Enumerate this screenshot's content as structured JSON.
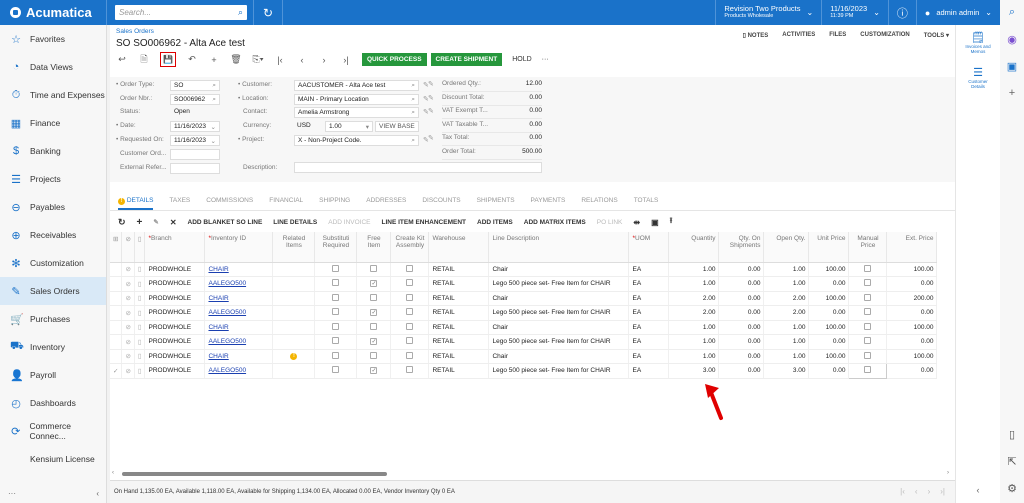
{
  "app": {
    "name": "Acumatica",
    "search_placeholder": "Search..."
  },
  "topbar": {
    "company_line1": "Revision Two Products",
    "company_line2": "Products Wholesale",
    "date_line1": "11/16/2023",
    "date_line2": "11:39 PM",
    "user": "admin admin"
  },
  "sidebar": {
    "items": [
      {
        "label": "Favorites",
        "icon": "star-icon",
        "glyph": "☆"
      },
      {
        "label": "Data Views",
        "icon": "pie-chart-icon",
        "glyph": "◔"
      },
      {
        "label": "Time and Expenses",
        "icon": "stopwatch-icon",
        "glyph": "⏱"
      },
      {
        "label": "Finance",
        "icon": "calculator-icon",
        "glyph": "▦"
      },
      {
        "label": "Banking",
        "icon": "dollar-icon",
        "glyph": "$"
      },
      {
        "label": "Projects",
        "icon": "projects-icon",
        "glyph": "☰"
      },
      {
        "label": "Payables",
        "icon": "minus-circle-icon",
        "glyph": "⊖"
      },
      {
        "label": "Receivables",
        "icon": "plus-circle-icon",
        "glyph": "⊕"
      },
      {
        "label": "Customization",
        "icon": "puzzle-icon",
        "glyph": "✻"
      },
      {
        "label": "Sales Orders",
        "icon": "edit-icon",
        "glyph": "✎",
        "active": true
      },
      {
        "label": "Purchases",
        "icon": "cart-icon",
        "glyph": "🛒"
      },
      {
        "label": "Inventory",
        "icon": "truck-icon",
        "glyph": "⛟"
      },
      {
        "label": "Payroll",
        "icon": "payroll-icon",
        "glyph": "👤"
      },
      {
        "label": "Dashboards",
        "icon": "gauge-icon",
        "glyph": "◴"
      },
      {
        "label": "Commerce Connec...",
        "icon": "sync-icon",
        "glyph": "⟳"
      },
      {
        "label": "Kensium License",
        "icon": "",
        "glyph": ""
      }
    ]
  },
  "page": {
    "breadcrumb": "Sales Orders",
    "title": "SO SO006962 - Alta Ace test",
    "top_tools": [
      "NOTES",
      "ACTIVITIES",
      "FILES",
      "CUSTOMIZATION",
      "TOOLS ▾"
    ],
    "actions": {
      "quick_process": "QUICK PROCESS",
      "create_shipment": "CREATE SHIPMENT",
      "hold": "HOLD",
      "more": "···"
    }
  },
  "form": {
    "order_type_label": "Order Type:",
    "order_type": "SO",
    "order_nbr_label": "Order Nbr.:",
    "order_nbr": "SO006962",
    "status_label": "Status:",
    "status": "Open",
    "date_label": "Date:",
    "date": "11/16/2023",
    "requested_on_label": "Requested On:",
    "requested_on": "11/16/2023",
    "customer_ord_label": "Customer Ord...",
    "customer_ord": "",
    "external_ref_label": "External Refer...",
    "external_ref": "",
    "customer_label": "Customer:",
    "customer": "AACUSTOMER - Alta Ace test",
    "location_label": "Location:",
    "location": "MAIN - Primary Location",
    "contact_label": "Contact:",
    "contact": "Amelia Armstrong",
    "currency_label": "Currency:",
    "currency": "USD",
    "rate": "1.00",
    "view_base": "VIEW BASE",
    "project_label": "Project:",
    "project": "X - Non-Project Code.",
    "description_label": "Description:",
    "description": "",
    "totals": [
      {
        "label": "Ordered Qty.:",
        "value": "12.00"
      },
      {
        "label": "Discount Total:",
        "value": "0.00"
      },
      {
        "label": "VAT Exempt T...",
        "value": "0.00"
      },
      {
        "label": "VAT Taxable T...",
        "value": "0.00"
      },
      {
        "label": "Tax Total:",
        "value": "0.00"
      },
      {
        "label": "Order Total:",
        "value": "500.00"
      }
    ]
  },
  "tabs": [
    "DETAILS",
    "TAXES",
    "COMMISSIONS",
    "FINANCIAL",
    "SHIPPING",
    "ADDRESSES",
    "DISCOUNTS",
    "SHIPMENTS",
    "PAYMENTS",
    "RELATIONS",
    "TOTALS"
  ],
  "grid_toolbar": [
    "ADD BLANKET SO LINE",
    "LINE DETAILS",
    "ADD INVOICE",
    "LINE ITEM ENHANCEMENT",
    "ADD ITEMS",
    "ADD MATRIX ITEMS",
    "PO LINK"
  ],
  "grid": {
    "columns": [
      "Branch",
      "Inventory ID",
      "Related Items",
      "Substituti Required",
      "Free Item",
      "Create Kit Assembly",
      "Warehouse",
      "Line Description",
      "UOM",
      "Quantity",
      "Qty. On Shipments",
      "Open Qty.",
      "Unit Price",
      "Manual Price",
      "Ext. Price"
    ],
    "rows": [
      {
        "branch": "PRODWHOLE",
        "item": "CHAIR",
        "free": false,
        "warehouse": "RETAIL",
        "desc": "Chair",
        "uom": "EA",
        "qty": "1.00",
        "ship": "0.00",
        "open": "1.00",
        "price": "100.00",
        "ext": "100.00"
      },
      {
        "branch": "PRODWHOLE",
        "item": "AALEGO500",
        "free": true,
        "warehouse": "RETAIL",
        "desc": "Lego 500 piece set- Free Item for CHAIR",
        "uom": "EA",
        "qty": "1.00",
        "ship": "0.00",
        "open": "1.00",
        "price": "0.00",
        "ext": "0.00"
      },
      {
        "branch": "PRODWHOLE",
        "item": "CHAIR",
        "free": false,
        "warehouse": "RETAIL",
        "desc": "Chair",
        "uom": "EA",
        "qty": "2.00",
        "ship": "0.00",
        "open": "2.00",
        "price": "100.00",
        "ext": "200.00"
      },
      {
        "branch": "PRODWHOLE",
        "item": "AALEGO500",
        "free": true,
        "warehouse": "RETAIL",
        "desc": "Lego 500 piece set- Free Item for CHAIR",
        "uom": "EA",
        "qty": "2.00",
        "ship": "0.00",
        "open": "2.00",
        "price": "0.00",
        "ext": "0.00"
      },
      {
        "branch": "PRODWHOLE",
        "item": "CHAIR",
        "free": false,
        "warehouse": "RETAIL",
        "desc": "Chair",
        "uom": "EA",
        "qty": "1.00",
        "ship": "0.00",
        "open": "1.00",
        "price": "100.00",
        "ext": "100.00"
      },
      {
        "branch": "PRODWHOLE",
        "item": "AALEGO500",
        "free": true,
        "warehouse": "RETAIL",
        "desc": "Lego 500 piece set- Free Item for CHAIR",
        "uom": "EA",
        "qty": "1.00",
        "ship": "0.00",
        "open": "1.00",
        "price": "0.00",
        "ext": "0.00"
      },
      {
        "branch": "PRODWHOLE",
        "item": "CHAIR",
        "free": false,
        "warning": true,
        "warehouse": "RETAIL",
        "desc": "Chair",
        "uom": "EA",
        "qty": "1.00",
        "ship": "0.00",
        "open": "1.00",
        "price": "100.00",
        "ext": "100.00"
      },
      {
        "branch": "PRODWHOLE",
        "item": "AALEGO500",
        "free": true,
        "warehouse": "RETAIL",
        "desc": "Lego 500 piece set- Free Item for CHAIR",
        "uom": "EA",
        "qty": "3.00",
        "ship": "0.00",
        "open": "3.00",
        "price": "0.00",
        "ext": "0.00",
        "selected": true
      }
    ]
  },
  "status_bar": "On Hand 1,135.00 EA, Available 1,118.00 EA, Available for Shipping 1,134.00 EA, Allocated 0.00 EA, Vendor Inventory Qty 0 EA",
  "right_panel": [
    {
      "label": "Invoices and Memos",
      "icon": "invoice-icon"
    },
    {
      "label": "Customer Details",
      "icon": "customer-details-icon"
    }
  ],
  "colors": {
    "brand": "#1a72c9",
    "action_green": "#26973c",
    "annotation_red": "#e00000"
  }
}
